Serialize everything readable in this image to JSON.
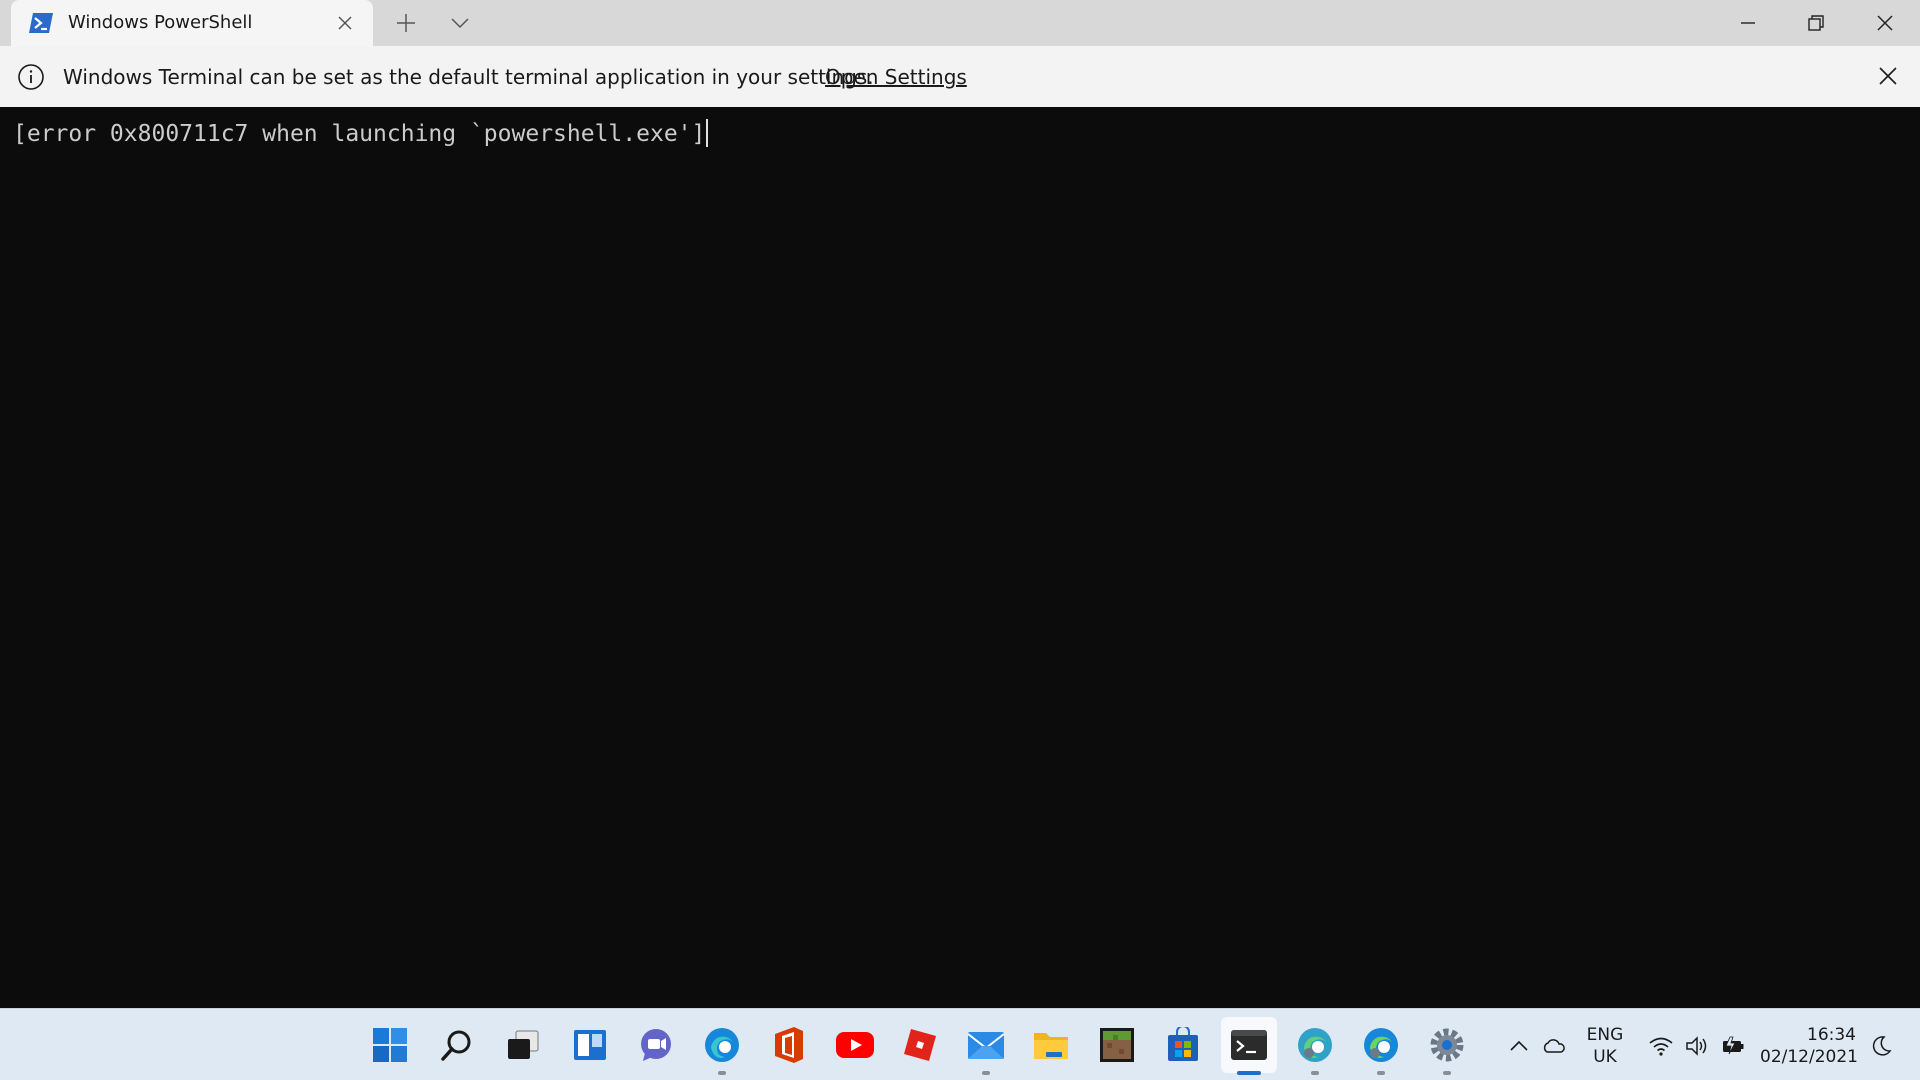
{
  "window": {
    "tab_title": "Windows PowerShell"
  },
  "infobar": {
    "message": "Windows Terminal can be set as the default terminal application in your settings.",
    "link": "Open Settings"
  },
  "terminal": {
    "output": "[error 0x800711c7 when launching `powershell.exe']"
  },
  "taskbar": {
    "icons": [
      "start-icon",
      "search-icon",
      "task-view-icon",
      "widgets-icon",
      "chat-icon",
      "edge-icon",
      "office-icon",
      "youtube-icon",
      "roblox-icon",
      "mail-icon",
      "file-explorer-icon",
      "minecraft-icon",
      "store-icon",
      "terminal-icon",
      "edge-beta-icon",
      "edge-dev-icon",
      "settings-icon"
    ],
    "active": "terminal-icon"
  },
  "tray": {
    "lang_line1": "ENG",
    "lang_line2": "UK",
    "time": "16:34",
    "date": "02/12/2021"
  },
  "colors": {
    "terminal_bg": "#0c0c0c",
    "terminal_fg": "#cccccc",
    "titlebar_bg": "#d8d8d8",
    "taskbar_bg": "#dfe9f4",
    "accent": "#1f6fc8"
  }
}
